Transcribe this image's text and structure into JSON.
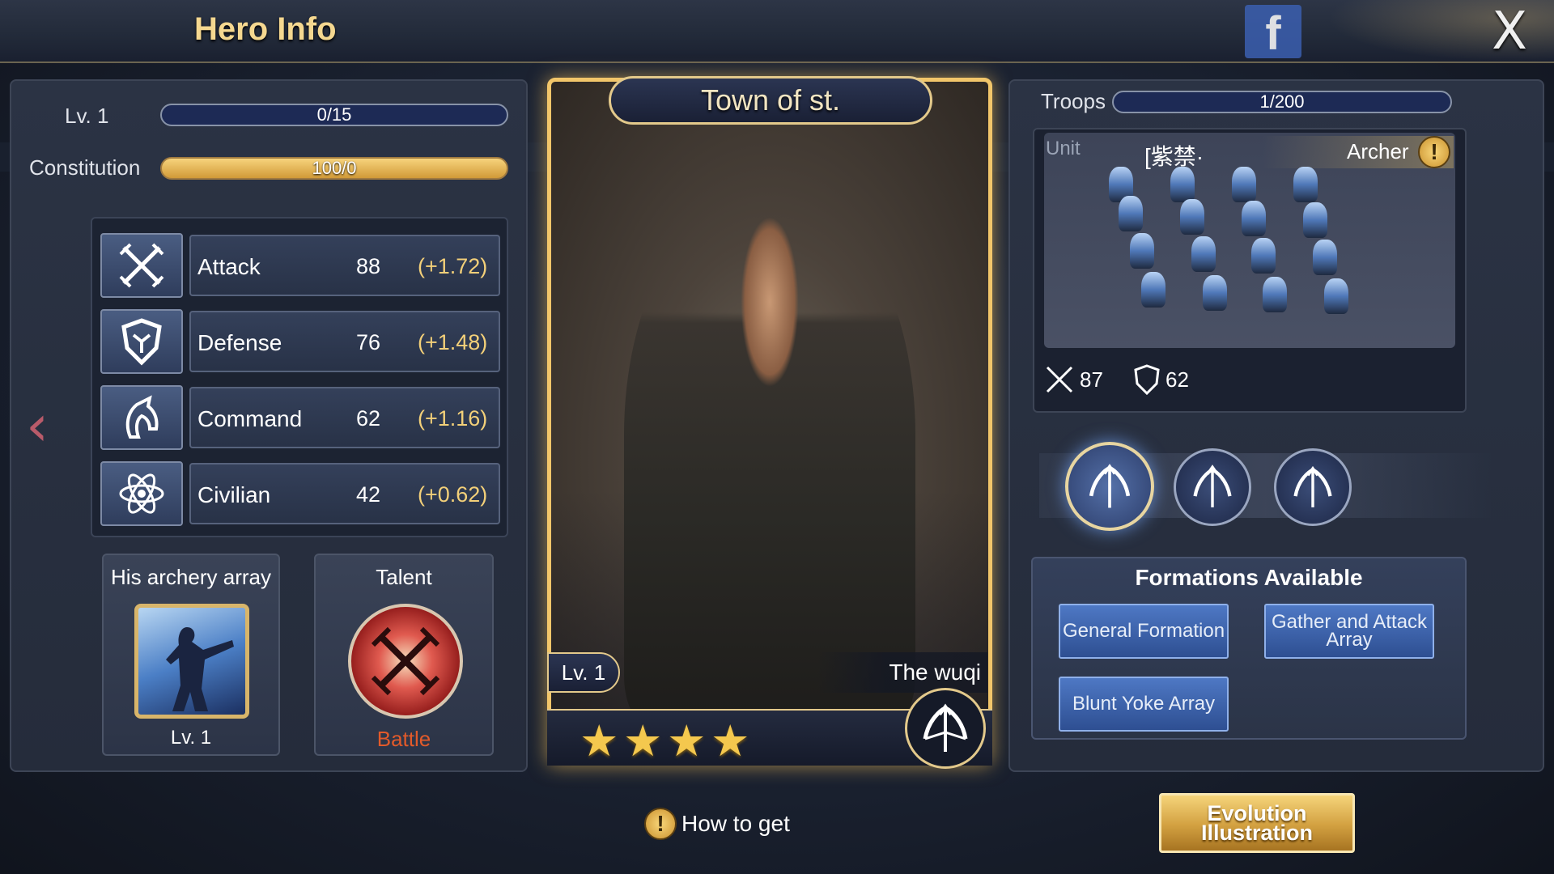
{
  "header": {
    "title": "Hero Info",
    "close_label": "X",
    "social_label": "f"
  },
  "hero": {
    "level_label": "Lv. 1",
    "exp": "0/15",
    "exp_fraction": 0,
    "constitution_label": "Constitution",
    "constitution_value": "100/0",
    "constitution_fraction": 1.0,
    "stats": [
      {
        "name": "Attack",
        "value": "88",
        "bonus": "(+1.72)",
        "icon": "crossed-swords-icon"
      },
      {
        "name": "Defense",
        "value": "76",
        "bonus": "(+1.48)",
        "icon": "shield-icon"
      },
      {
        "name": "Command",
        "value": "62",
        "bonus": "(+1.16)",
        "icon": "horse-head-icon"
      },
      {
        "name": "Civilian",
        "value": "42",
        "bonus": "(+0.62)",
        "icon": "atom-icon"
      }
    ],
    "skill": {
      "title": "His archery array",
      "level": "Lv. 1"
    },
    "talent": {
      "title": "Talent",
      "label": "Battle"
    }
  },
  "card": {
    "banner": "Town of st.",
    "level": "Lv. 1",
    "name": "The wuqi",
    "stars": 4,
    "class_icon": "bow-icon"
  },
  "troops": {
    "label": "Troops",
    "value": "1/200",
    "fraction": 0.005,
    "unit_label": "Unit",
    "unit_name": "[紫禁·",
    "unit_type": "Archer",
    "attack": "87",
    "defense": "62"
  },
  "classes": [
    "bow-icon",
    "spear-icon",
    "bow-icon"
  ],
  "formations": {
    "title": "Formations Available",
    "items": [
      "General Formation",
      "Gather and Attack Array",
      "Blunt Yoke Array"
    ]
  },
  "footer": {
    "how_to_get": "How to get",
    "evolution": "Evolution Illustration"
  },
  "colors": {
    "accent_gold": "#f2c66a",
    "bar_blue": "#1d2a55",
    "talent_red": "#e25a2a"
  }
}
